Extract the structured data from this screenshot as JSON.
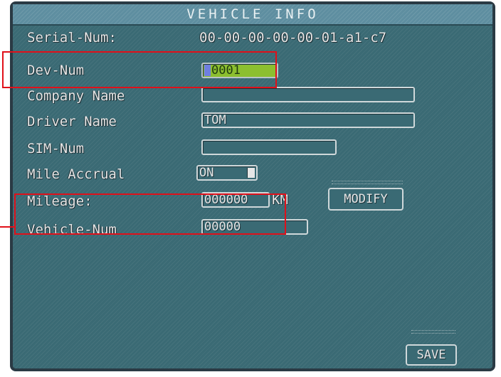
{
  "title": "VEHICLE INFO",
  "serial": {
    "label": "Serial-Num:",
    "value": "00-00-00-00-00-01-a1-c7"
  },
  "dev_num": {
    "label": "Dev-Num",
    "value": "0001"
  },
  "company_name": {
    "label": "Company Name",
    "value": ""
  },
  "driver_name": {
    "label": "Driver Name",
    "value": "TOM"
  },
  "sim_num": {
    "label": "SIM-Num",
    "value": ""
  },
  "mile_accrual": {
    "label": "Mile Accrual",
    "value": "ON"
  },
  "mileage": {
    "label": "Mileage:",
    "value": "000000",
    "unit": "KM",
    "modify_label": "MODIFY"
  },
  "vehicle_num": {
    "label": "Vehicle-Num",
    "value": "00000"
  },
  "save_label": "SAVE",
  "colors": {
    "panel": "#3a6a74",
    "title_bar": "#5e8ea0",
    "highlight_field": "#8cbf2f",
    "annotation_red": "#e0101a"
  }
}
